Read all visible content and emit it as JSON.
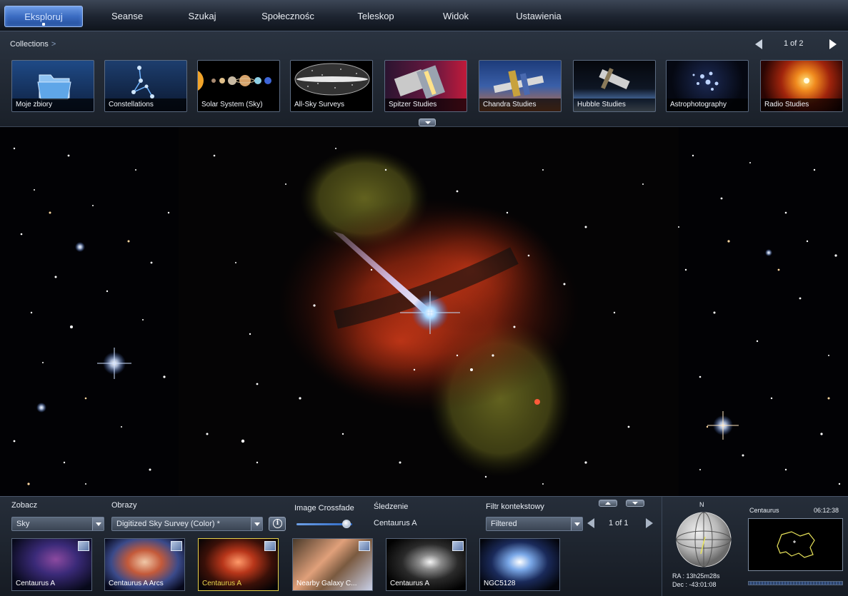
{
  "menu": {
    "items": [
      {
        "label": "Eksploruj",
        "active": true
      },
      {
        "label": "Seanse"
      },
      {
        "label": "Szukaj"
      },
      {
        "label": "Społecznośc"
      },
      {
        "label": "Teleskop"
      },
      {
        "label": "Widok"
      },
      {
        "label": "Ustawienia"
      }
    ]
  },
  "collections": {
    "breadcrumb": "Collections",
    "breadcrumb_sep": ">",
    "page": "1 of 2",
    "items": [
      {
        "label": "Moje zbiory",
        "icon": "folder-icon"
      },
      {
        "label": "Constellations",
        "icon": "constellation-icon"
      },
      {
        "label": "Solar System (Sky)",
        "icon": "planets-icon"
      },
      {
        "label": "All-Sky Surveys",
        "icon": "all-sky-map-icon"
      },
      {
        "label": "Spitzer Studies",
        "icon": "spitzer-telescope-icon"
      },
      {
        "label": "Chandra Studies",
        "icon": "chandra-telescope-icon"
      },
      {
        "label": "Hubble Studies",
        "icon": "hubble-telescope-icon"
      },
      {
        "label": "Astrophotography",
        "icon": "star-cluster-icon"
      },
      {
        "label": "Radio Studies",
        "icon": "radio-nebula-icon"
      }
    ]
  },
  "bottom": {
    "look_label": "Zobacz",
    "look_value": "Sky",
    "imagery_label": "Obrazy",
    "imagery_value": "Digitized Sky Survey (Color) *",
    "crossfade_label": "Image Crossfade",
    "crossfade_level": 0.9,
    "tracking_label": "Śledzenie",
    "tracking_value": "Centaurus A",
    "filter_label": "Filtr kontekstowy",
    "filter_value": "Filtered",
    "page": "1 of 1",
    "results": [
      {
        "label": "Centaurus A"
      },
      {
        "label": "Centaurus A Arcs"
      },
      {
        "label": "Centaurus A",
        "selected": true
      },
      {
        "label": "Nearby Galaxy C..."
      },
      {
        "label": "Centaurus A"
      },
      {
        "label": "NGC5128"
      }
    ]
  },
  "nav": {
    "north": "N",
    "constellation": "Centaurus",
    "time": "06:12:38",
    "ra": "RA : 13h25m28s",
    "dec": "Dec : -43:01:08"
  },
  "colors": {
    "accent": "#3b6cc2",
    "selected_outline": "#e6d24a",
    "constellation_line": "#e8e35a"
  }
}
